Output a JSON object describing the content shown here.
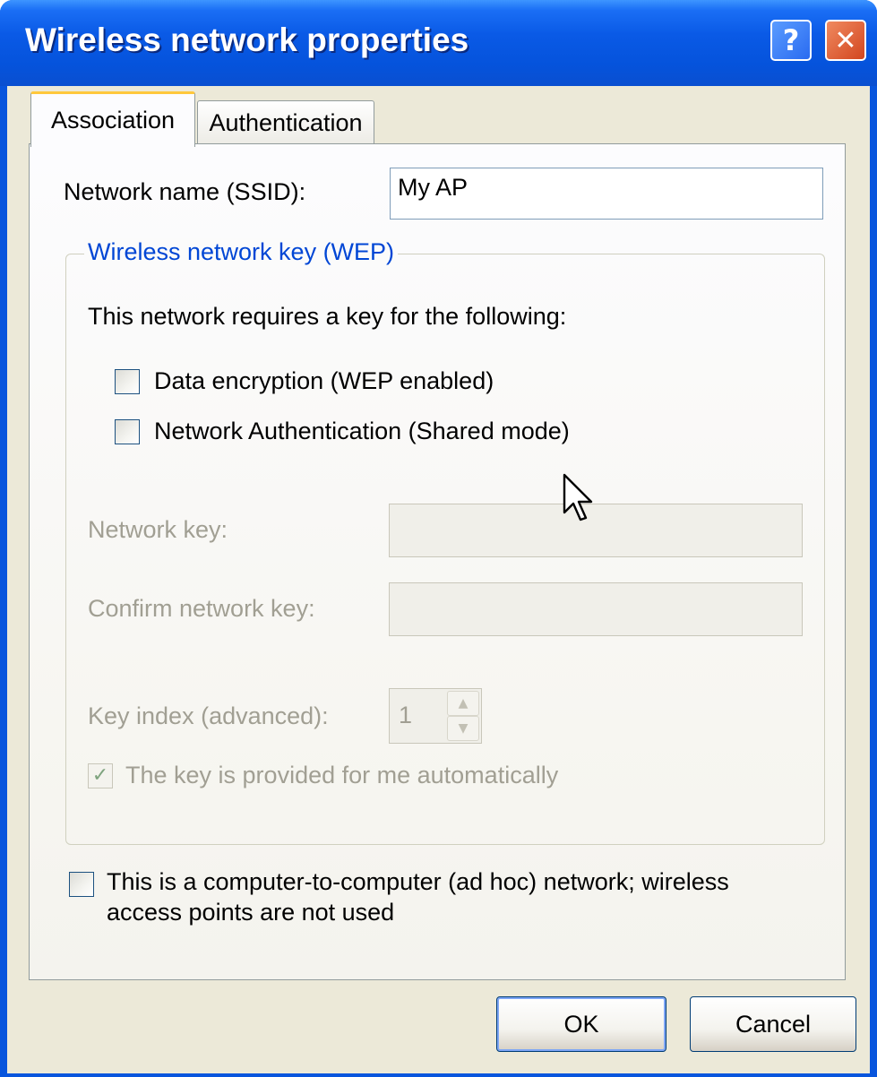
{
  "window": {
    "title": "Wireless network properties",
    "help_glyph": "?",
    "close_glyph": "✕"
  },
  "tabs": [
    {
      "label": "Association",
      "active": true
    },
    {
      "label": "Authentication",
      "active": false
    }
  ],
  "association": {
    "ssid_label": "Network name (SSID):",
    "ssid_value": "My AP",
    "group_title": "Wireless network key (WEP)",
    "requires_text": "This network requires a key for the following:",
    "data_encryption": {
      "label": "Data encryption (WEP enabled)",
      "checked": false
    },
    "network_auth": {
      "label": "Network Authentication (Shared mode)",
      "checked": false
    },
    "network_key_label": "Network key:",
    "network_key_value": "",
    "confirm_key_label": "Confirm network key:",
    "confirm_key_value": "",
    "key_index_label": "Key index (advanced):",
    "key_index_value": "1",
    "auto_key": {
      "label": "The key is provided for me automatically",
      "checked": true,
      "disabled": true
    },
    "adhoc": {
      "label_line1": "This is a computer-to-computer (ad hoc) network; wireless",
      "label_line2": "access points are not used",
      "checked": false
    }
  },
  "buttons": {
    "ok": "OK",
    "cancel": "Cancel"
  },
  "icons": {
    "check": "✓",
    "spin_up": "▲",
    "spin_down": "▼"
  },
  "colors": {
    "titlebar": "#0553dc",
    "group_title": "#0046d5",
    "disabled_text": "#a19f93",
    "dialog_bg": "#ece9d8"
  }
}
